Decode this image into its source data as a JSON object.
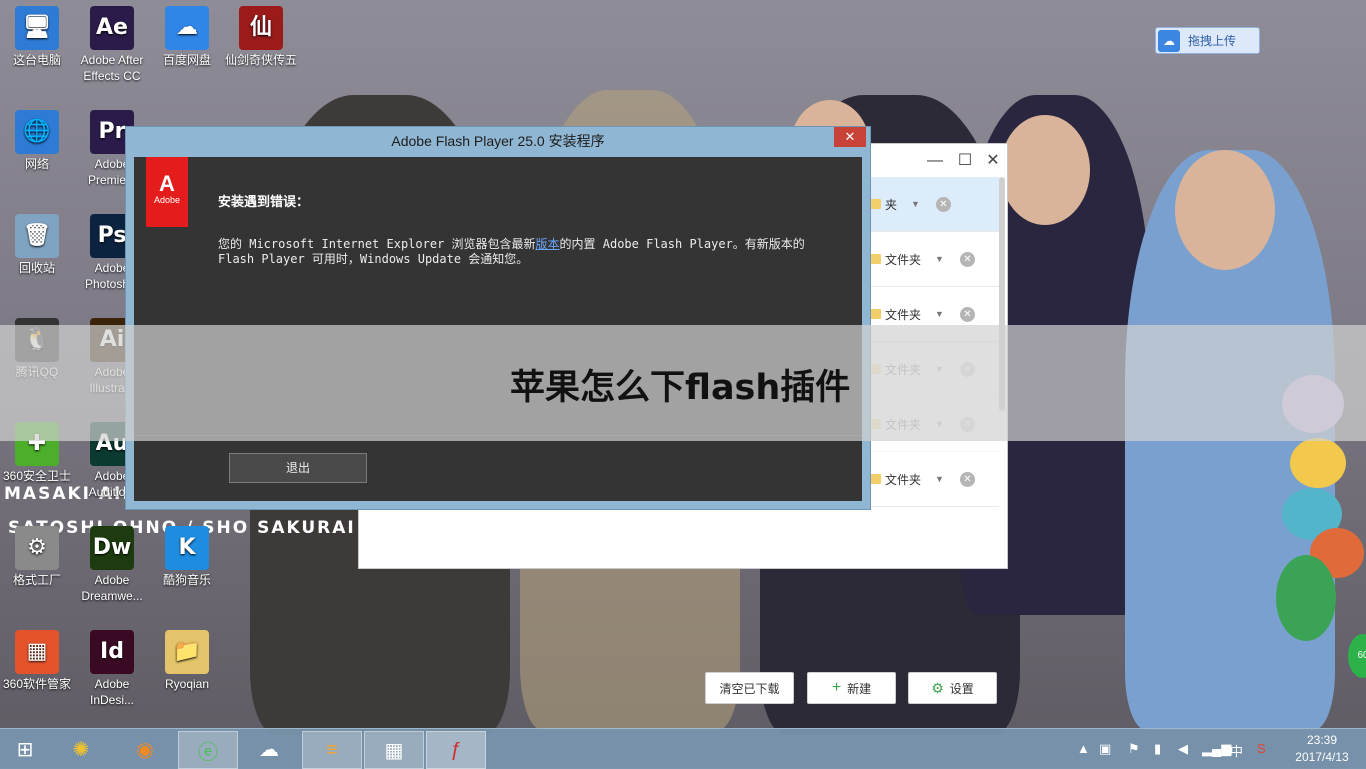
{
  "desktop": {
    "icons": [
      {
        "label": "这台电脑",
        "glyph": "🖥",
        "color": "#2e7bd6"
      },
      {
        "label": "Adobe After Effects CC",
        "glyph": "Ae",
        "color": "#2b1b4a"
      },
      {
        "label": "百度网盘",
        "glyph": "☁",
        "color": "#2f86e6"
      },
      {
        "label": "仙剑奇侠传五",
        "glyph": "仙",
        "color": "#9b1b1b"
      },
      {
        "label": "网络",
        "glyph": "🌐",
        "color": "#2e7bd6"
      },
      {
        "label": "Adobe Premie...",
        "glyph": "Pr",
        "color": "#2b1b4a"
      },
      {
        "label": "回收站",
        "glyph": "🗑",
        "color": "#7fa3c0"
      },
      {
        "label": "Adobe Photosh...",
        "glyph": "Ps",
        "color": "#0c2340"
      },
      {
        "label": "腾讯QQ",
        "glyph": "🐧",
        "color": "#333333"
      },
      {
        "label": "Adobe Illustra...",
        "glyph": "Ai",
        "color": "#3a2308"
      },
      {
        "label": "360安全卫士",
        "glyph": "✚",
        "color": "#4caf2a"
      },
      {
        "label": "Adobe Auditio...",
        "glyph": "Au",
        "color": "#0a3a30"
      },
      {
        "label": "格式工厂",
        "glyph": "⚙",
        "color": "#8a8a8a"
      },
      {
        "label": "Adobe Dreamwe...",
        "glyph": "Dw",
        "color": "#1e3b0f"
      },
      {
        "label": "酷狗音乐",
        "glyph": "K",
        "color": "#1e8de0"
      },
      {
        "label": "360软件管家",
        "glyph": "▦",
        "color": "#e5532b"
      },
      {
        "label": "Adobe InDesi...",
        "glyph": "Id",
        "color": "#3a0a24"
      },
      {
        "label": "Ryoqian",
        "glyph": "📁",
        "color": "#e3c46a"
      }
    ],
    "wallpaper_text": [
      "MASAKI AIBA",
      "SATOSHI OHNO / SHO SAKURAI"
    ]
  },
  "upload_button": {
    "label": "拖拽上传"
  },
  "download_window": {
    "rows": [
      {
        "label": "夹",
        "faded": false
      },
      {
        "label": "文件夹",
        "faded": false
      },
      {
        "label": "文件夹",
        "faded": false
      },
      {
        "label": "文件夹",
        "faded": true
      },
      {
        "label": "文件夹",
        "faded": true
      },
      {
        "label": "文件夹",
        "faded": false
      }
    ],
    "buttons": {
      "clear": "清空已下载",
      "new": "新建",
      "settings": "设置"
    }
  },
  "flash_dialog": {
    "title": "Adobe Flash Player 25.0 安装程序",
    "logo_text": "Adobe",
    "heading": "安装遇到错误：",
    "message_before": "您的 Microsoft Internet Explorer 浏览器包含最新",
    "message_link": "版本",
    "message_after": "的内置 Adobe Flash Player。有新版本的 Flash Player 可用时，Windows Update 会通知您。",
    "exit_label": "退出"
  },
  "banner": {
    "text": "苹果怎么下flash插件"
  },
  "taskbar": {
    "time": "23:39",
    "date": "2017/4/13",
    "ime": "中",
    "badge": "60"
  }
}
